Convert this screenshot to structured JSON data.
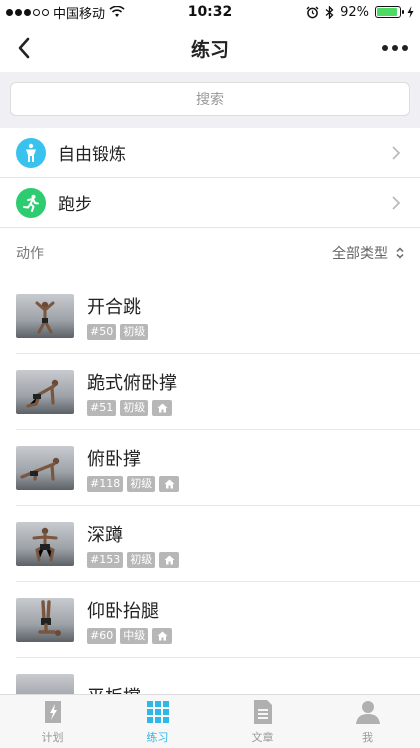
{
  "status": {
    "carrier": "中国移动",
    "time": "10:32",
    "battery": "92%",
    "battery_level": 0.92
  },
  "nav": {
    "title": "练习"
  },
  "search": {
    "placeholder": "搜索"
  },
  "entries": [
    {
      "label": "自由锻炼",
      "color": "#3ac2ee",
      "icon": "person-standing-icon"
    },
    {
      "label": "跑步",
      "color": "#2ecc71",
      "icon": "running-icon"
    }
  ],
  "section": {
    "title": "动作",
    "filter": "全部类型"
  },
  "exercises": [
    {
      "name": "开合跳",
      "num": "#50",
      "level": "初级",
      "home": false
    },
    {
      "name": "跪式俯卧撑",
      "num": "#51",
      "level": "初级",
      "home": true
    },
    {
      "name": "俯卧撑",
      "num": "#118",
      "level": "初级",
      "home": true
    },
    {
      "name": "深蹲",
      "num": "#153",
      "level": "初级",
      "home": true
    },
    {
      "name": "仰卧抬腿",
      "num": "#60",
      "level": "中级",
      "home": true
    },
    {
      "name": "平板撑",
      "num": "",
      "level": "",
      "home": false
    }
  ],
  "tabs": [
    {
      "label": "计划",
      "icon": "plan-icon",
      "active": false
    },
    {
      "label": "练习",
      "icon": "grid-icon",
      "active": true
    },
    {
      "label": "文章",
      "icon": "document-icon",
      "active": false
    },
    {
      "label": "我",
      "icon": "profile-icon",
      "active": false
    }
  ],
  "colors": {
    "accent": "#2fb7e6",
    "tag": "#b7b7b7"
  }
}
